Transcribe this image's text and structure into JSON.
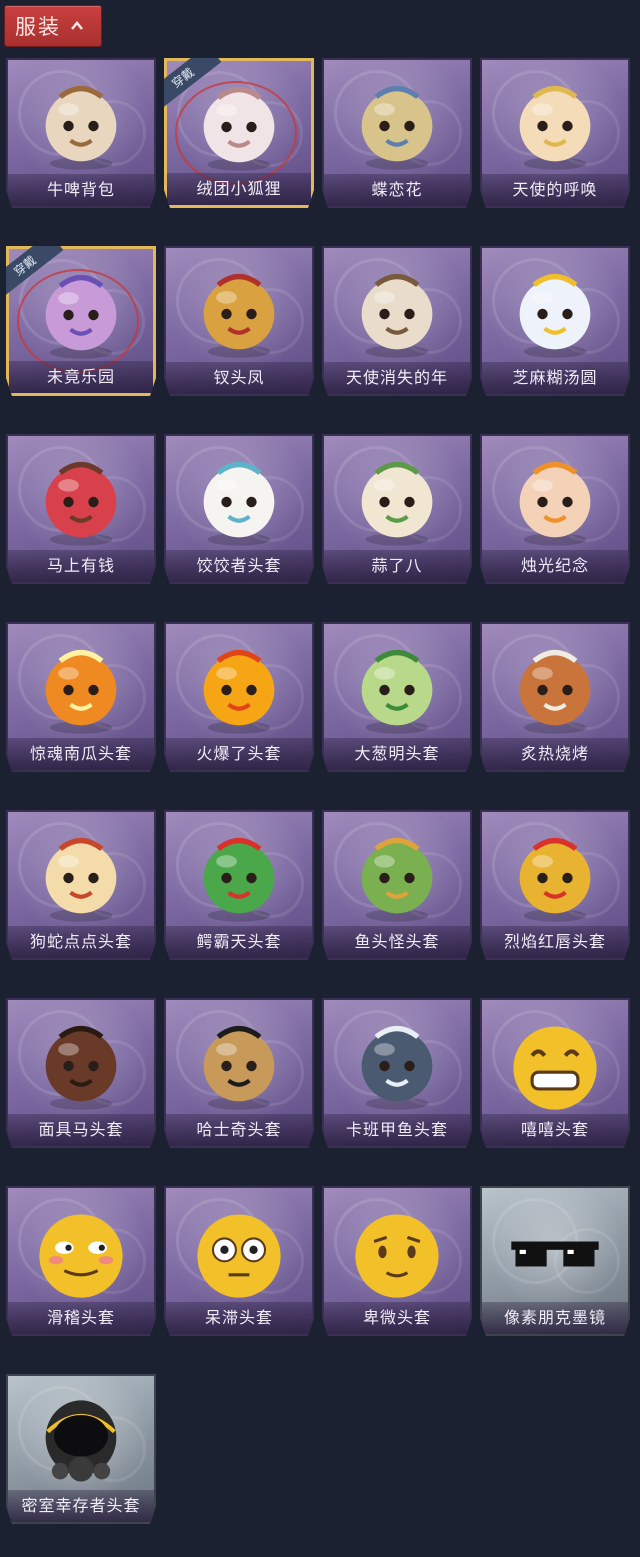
{
  "header": {
    "title": "服装"
  },
  "equipped_label": "穿戴",
  "items": [
    {
      "label": "牛啤背包",
      "icon": "beer-cow-backpack",
      "color": "#e8d6bf",
      "accent": "#9a6a3a",
      "equipped": false,
      "tier": "purple"
    },
    {
      "label": "绒团小狐狸",
      "icon": "fluffy-fox",
      "color": "#f1e4e6",
      "accent": "#b98a8a",
      "equipped": true,
      "tier": "purple"
    },
    {
      "label": "蝶恋花",
      "icon": "butterfly-bell",
      "color": "#d8c48a",
      "accent": "#5d7fb0",
      "equipped": false,
      "tier": "purple"
    },
    {
      "label": "天使的呼唤",
      "icon": "angel-doll",
      "color": "#f4dcb8",
      "accent": "#e0b850",
      "equipped": false,
      "tier": "purple"
    },
    {
      "label": "未竟乐园",
      "icon": "paradise-doll",
      "color": "#c89ad8",
      "accent": "#6a4fb4",
      "equipped": true,
      "tier": "purple"
    },
    {
      "label": "钗头凤",
      "icon": "phoenix-crown-doll",
      "color": "#d9a13f",
      "accent": "#b0302a",
      "equipped": false,
      "tier": "purple"
    },
    {
      "label": "天使消失的年",
      "icon": "lost-angel-doll",
      "color": "#e9dccb",
      "accent": "#7a5a3e",
      "equipped": false,
      "tier": "purple"
    },
    {
      "label": "芝麻糊汤圆",
      "icon": "sesame-dumpling",
      "color": "#eef2fb",
      "accent": "#f0c02a",
      "equipped": false,
      "tier": "purple"
    },
    {
      "label": "马上有钱",
      "icon": "horse-money-head",
      "color": "#d8414b",
      "accent": "#6b3a2a",
      "equipped": false,
      "tier": "purple"
    },
    {
      "label": "饺饺者头套",
      "icon": "dumpling-head",
      "color": "#f6f4f0",
      "accent": "#5fb3c9",
      "equipped": false,
      "tier": "purple"
    },
    {
      "label": "蒜了八",
      "icon": "garlic-head",
      "color": "#f1e6d2",
      "accent": "#5c9a48",
      "equipped": false,
      "tier": "purple"
    },
    {
      "label": "烛光纪念",
      "icon": "candle-head",
      "color": "#f3d2b8",
      "accent": "#f0902a",
      "equipped": false,
      "tier": "purple"
    },
    {
      "label": "惊魂南瓜头套",
      "icon": "pumpkin-head",
      "color": "#ef8a22",
      "accent": "#fff2a0",
      "equipped": false,
      "tier": "purple"
    },
    {
      "label": "火爆了头套",
      "icon": "fire-head",
      "color": "#f6a515",
      "accent": "#e0451a",
      "equipped": false,
      "tier": "purple"
    },
    {
      "label": "大葱明头套",
      "icon": "scallion-head",
      "color": "#b9d98a",
      "accent": "#3d8a3a",
      "equipped": false,
      "tier": "purple"
    },
    {
      "label": "炙热烧烤",
      "icon": "bbq-meat-head",
      "color": "#c8743a",
      "accent": "#f1ece2",
      "equipped": false,
      "tier": "purple"
    },
    {
      "label": "狗蛇点点头套",
      "icon": "snake-head",
      "color": "#f3dcaa",
      "accent": "#c8462a",
      "equipped": false,
      "tier": "purple"
    },
    {
      "label": "鳄霸天头套",
      "icon": "crocodile-head",
      "color": "#4aa84a",
      "accent": "#d8322a",
      "equipped": false,
      "tier": "purple"
    },
    {
      "label": "鱼头怪头套",
      "icon": "fish-mask",
      "color": "#7ab050",
      "accent": "#e0a23a",
      "equipped": false,
      "tier": "purple"
    },
    {
      "label": "烈焰红唇头套",
      "icon": "yellow-mask-sunglasses",
      "color": "#e8b330",
      "accent": "#d8322a",
      "equipped": false,
      "tier": "purple"
    },
    {
      "label": "面具马头套",
      "icon": "horse-mask",
      "color": "#6a3a28",
      "accent": "#2a1a12",
      "equipped": false,
      "tier": "purple"
    },
    {
      "label": "哈士奇头套",
      "icon": "husky-mask",
      "color": "#c89a5a",
      "accent": "#1c1c1c",
      "equipped": false,
      "tier": "purple"
    },
    {
      "label": "卡班甲鱼头套",
      "icon": "fish-head",
      "color": "#4a5a70",
      "accent": "#e8eef4",
      "equipped": false,
      "tier": "purple"
    },
    {
      "label": "嘻嘻头套",
      "icon": "grin-emoji-head",
      "color": "#f2c12a",
      "accent": "#5a3a1a",
      "equipped": false,
      "tier": "purple"
    },
    {
      "label": "滑稽头套",
      "icon": "funny-emoji-head",
      "color": "#f2c12a",
      "accent": "#f08a7a",
      "equipped": false,
      "tier": "purple"
    },
    {
      "label": "呆滞头套",
      "icon": "stare-emoji-head",
      "color": "#f2c12a",
      "accent": "#5a3a1a",
      "equipped": false,
      "tier": "purple"
    },
    {
      "label": "卑微头套",
      "icon": "humble-emoji-head",
      "color": "#f2c12a",
      "accent": "#5a3a1a",
      "equipped": false,
      "tier": "purple"
    },
    {
      "label": "像素朋克墨镜",
      "icon": "pixel-sunglasses",
      "color": "#111111",
      "accent": "#ffffff",
      "equipped": false,
      "tier": "grey"
    },
    {
      "label": "密室幸存者头套",
      "icon": "gas-mask-helmet",
      "color": "#2a2a2a",
      "accent": "#f0c02a",
      "equipped": false,
      "tier": "grey"
    }
  ]
}
